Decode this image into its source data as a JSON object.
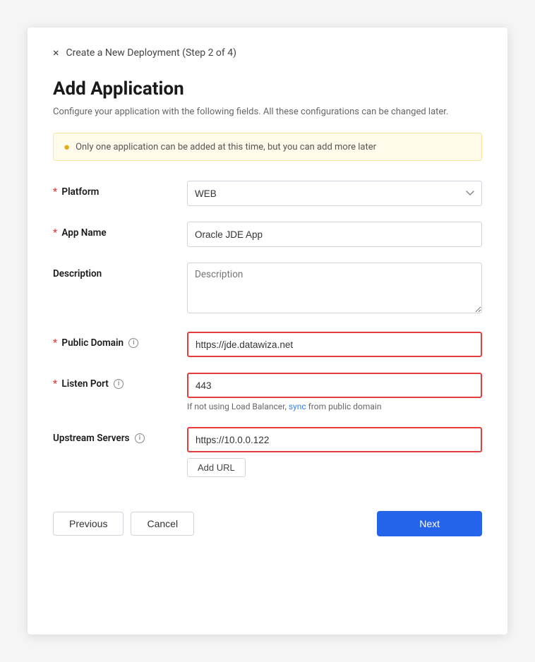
{
  "header": {
    "close_label": "×",
    "title": "Create a New Deployment (Step 2 of 4)"
  },
  "page": {
    "heading": "Add Application",
    "subtitle": "Configure your application with the following fields. All these configurations can be changed later."
  },
  "alert": {
    "message": "Only one application can be added at this time, but you can add more later"
  },
  "form": {
    "platform_label": "Platform",
    "platform_value": "WEB",
    "appname_label": "App Name",
    "appname_value": "Oracle JDE App",
    "description_label": "Description",
    "description_placeholder": "Description",
    "public_domain_label": "Public Domain",
    "public_domain_value": "https://jde.datawiza.net",
    "listen_port_label": "Listen Port",
    "listen_port_value": "443",
    "listen_port_hint": "If not using Load Balancer,",
    "listen_port_hint_link": "sync",
    "listen_port_hint_suffix": "from public domain",
    "upstream_label": "Upstream Servers",
    "upstream_value": "https://10.0.0.122",
    "add_url_label": "Add URL"
  },
  "footer": {
    "previous_label": "Previous",
    "cancel_label": "Cancel",
    "next_label": "Next"
  }
}
